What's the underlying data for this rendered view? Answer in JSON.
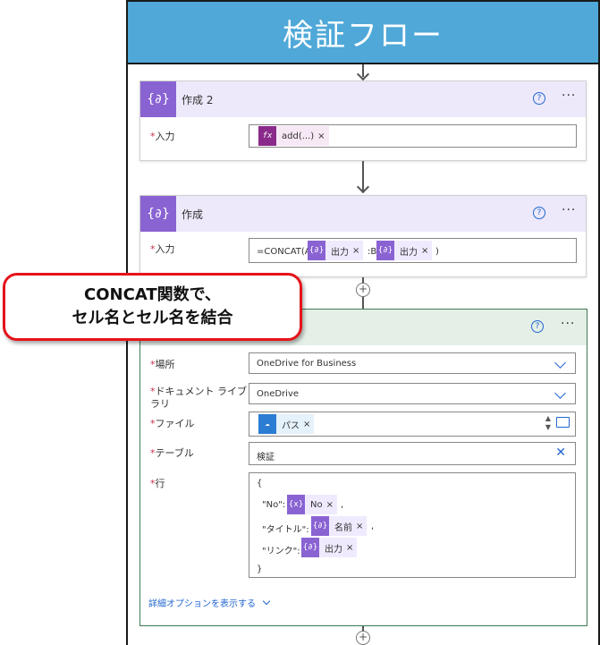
{
  "header": {
    "title": "検証フロー"
  },
  "compose2": {
    "title": "作成 2",
    "input_label": "入力",
    "token_icon": "fx",
    "token_label": "add(...)"
  },
  "compose": {
    "title": "作成",
    "input_label": "入力",
    "prefix_text": "=CONCAT(A",
    "token1_label": "出力",
    "mid_text": ":B",
    "token2_label": "出力",
    "suffix_text": ")"
  },
  "callout": {
    "line1": "CONCAT関数で、",
    "line2": "セル名とセル名を結合"
  },
  "excel": {
    "location_label": "場所",
    "location_value": "OneDrive for Business",
    "library_label_1": "ドキュメント ライブ",
    "library_label_2": "ラリ",
    "library_value": "OneDrive",
    "file_label": "ファイル",
    "file_token": "パス",
    "table_label": "テーブル",
    "table_value": "検証",
    "row_label": "行",
    "json_open": "{",
    "json_close": "}",
    "rows": [
      {
        "key": "\"No\":",
        "token": "No",
        "icon": "{x}",
        "trail": ","
      },
      {
        "key": "\"タイトル\":",
        "token": "名前",
        "icon": "{∂}",
        "trail": ","
      },
      {
        "key": "\"リンク\":",
        "token": "出力",
        "icon": "{∂}",
        "trail": ""
      }
    ],
    "advanced_link": "詳細オプションを表示する"
  },
  "colors": {
    "accent_purple": "#8a63d2",
    "fx_purple": "#8a2a8a",
    "header_blue": "#4fa8d8",
    "callout_red": "#e6131a",
    "excel_green": "#3f7a54"
  },
  "icons": {
    "compose": "compose-icon",
    "more": "ellipsis-icon",
    "help": "help-icon",
    "onedrive": "onedrive-icon"
  }
}
